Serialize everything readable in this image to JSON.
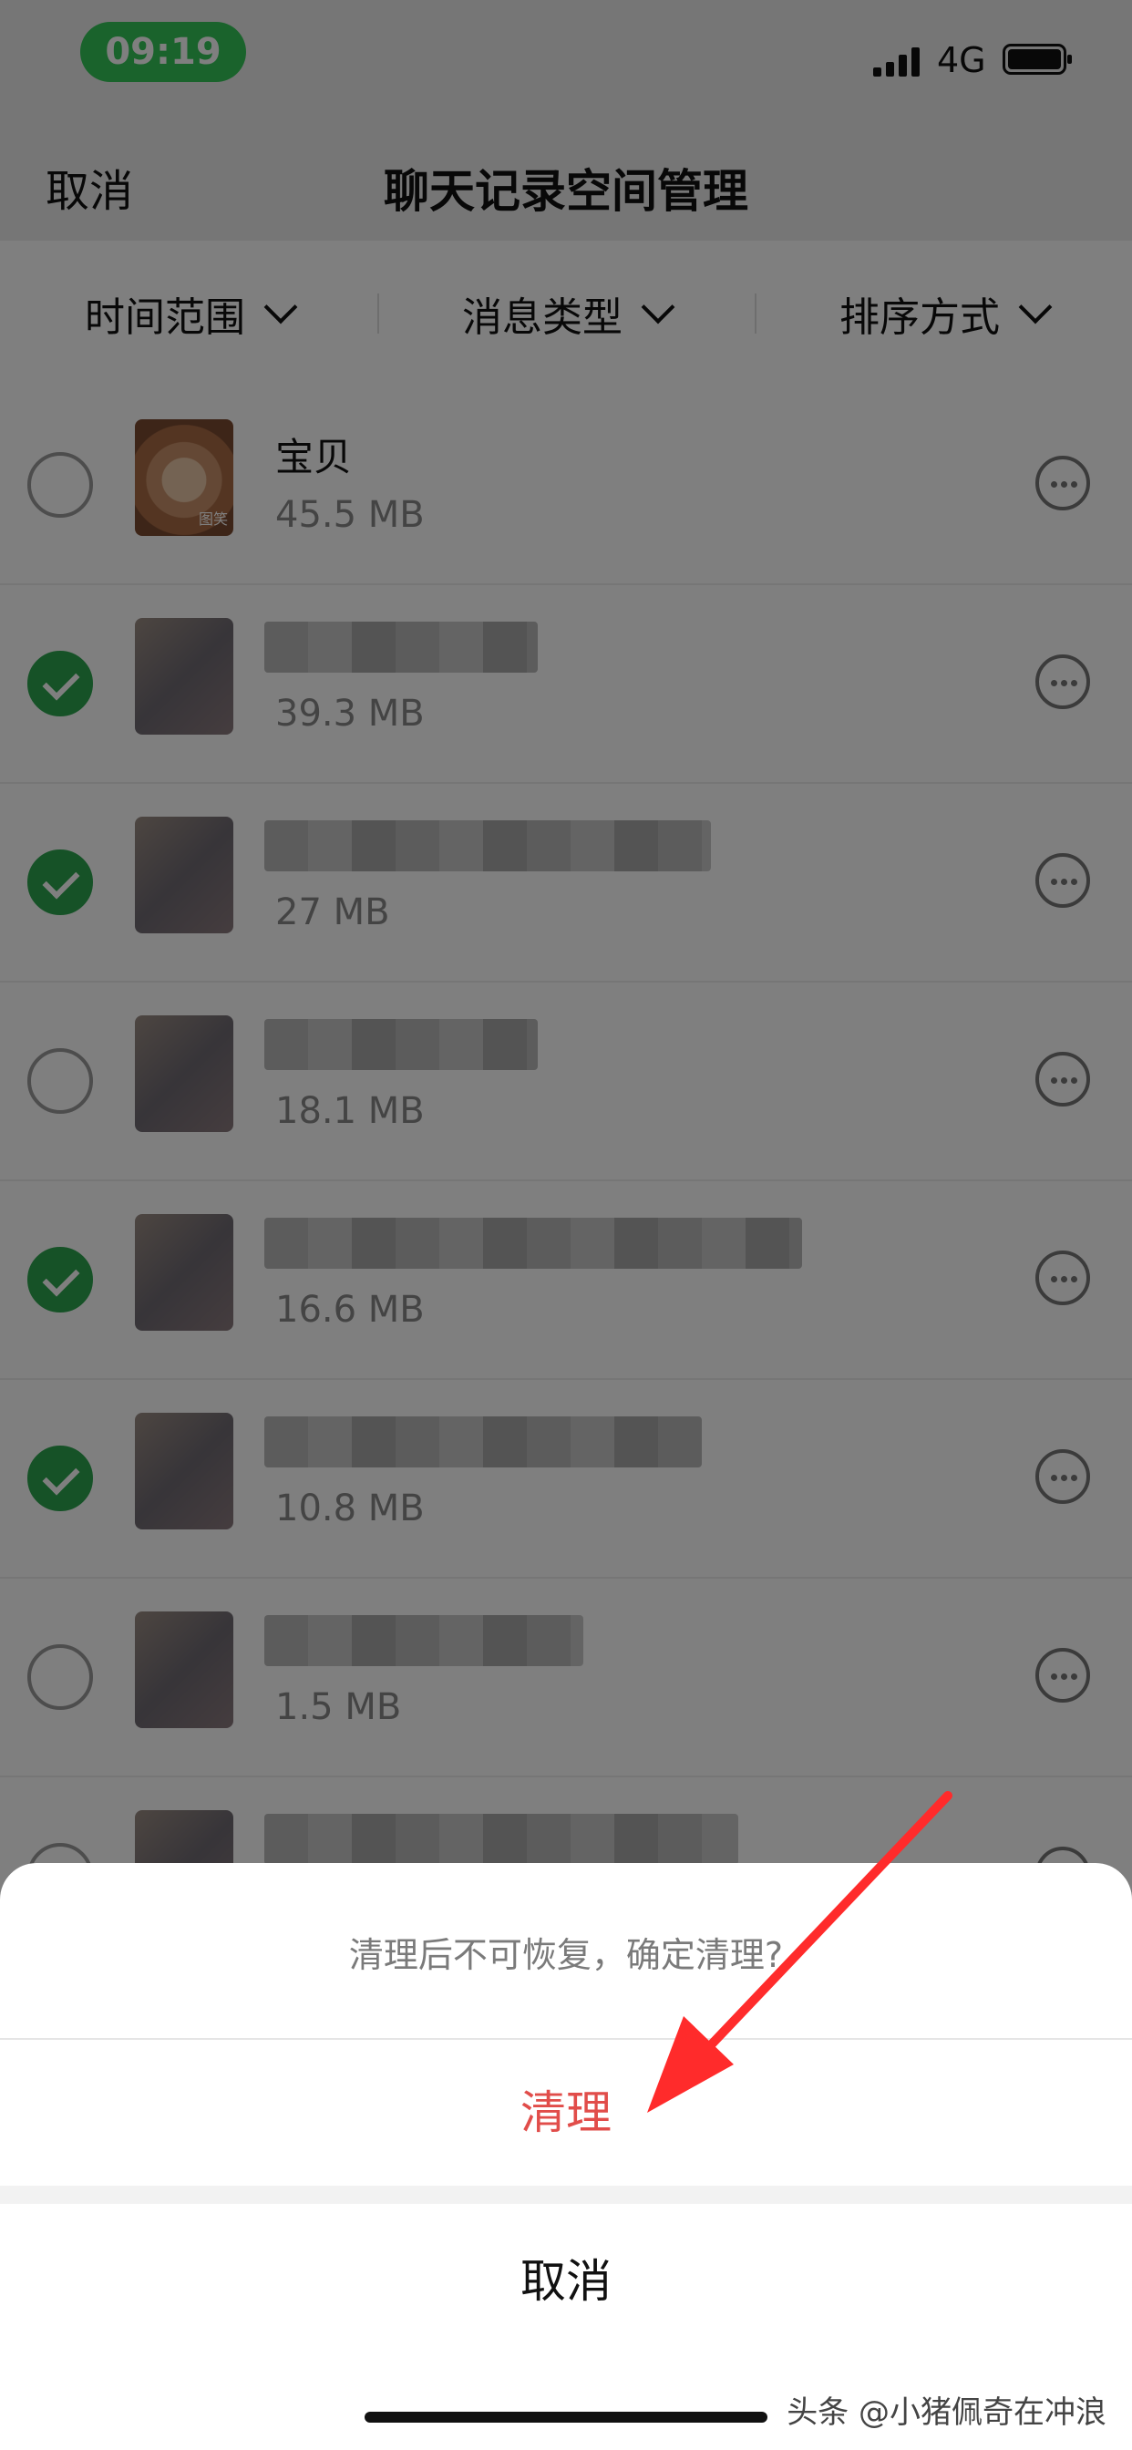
{
  "status": {
    "time": "09:19",
    "network": "4G"
  },
  "nav": {
    "cancel": "取消",
    "title": "聊天记录空间管理"
  },
  "filters": [
    {
      "label": "时间范围"
    },
    {
      "label": "消息类型"
    },
    {
      "label": "排序方式"
    }
  ],
  "rows": [
    {
      "name": "宝贝",
      "size": "45.5 MB",
      "checked": false,
      "blurred": false
    },
    {
      "size": "39.3 MB",
      "checked": true,
      "blurred": true
    },
    {
      "size": "27 MB",
      "checked": true,
      "blurred": true
    },
    {
      "size": "18.1 MB",
      "checked": false,
      "blurred": true
    },
    {
      "size": "16.6 MB",
      "checked": true,
      "blurred": true
    },
    {
      "size": "10.8 MB",
      "checked": true,
      "blurred": true
    },
    {
      "size": "1.5 MB",
      "checked": false,
      "blurred": true
    }
  ],
  "sheet": {
    "message": "清理后不可恢复，确定清理?",
    "confirm": "清理",
    "cancel": "取消"
  },
  "avatar_tag": "图笑",
  "watermark": "头条 @小猪佩奇在冲浪",
  "colors": {
    "status_pill": "#34c759",
    "checked": "#2da44e",
    "confirm_text": "#e14d4a",
    "arrow": "#ff2b2b"
  }
}
